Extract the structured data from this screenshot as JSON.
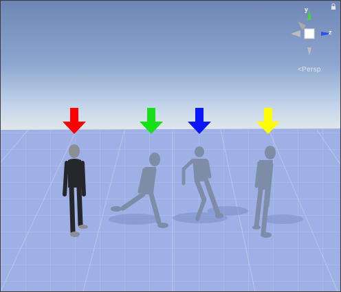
{
  "viewport": {
    "projection_label": "Persp"
  },
  "gizmo": {
    "axes": {
      "y": "y",
      "z": "z"
    },
    "colors": {
      "y": "#46d246",
      "z": "#2f52e0",
      "x_neg": "#bdbdbd",
      "center": "#ffffff"
    }
  },
  "markers": [
    {
      "name": "red",
      "color": "#ff0000"
    },
    {
      "name": "green",
      "color": "#18e018"
    },
    {
      "name": "blue",
      "color": "#0a16ff"
    },
    {
      "name": "yellow",
      "color": "#ffff00"
    }
  ],
  "characters": [
    {
      "name": "dark-figure",
      "color": "#25272b"
    },
    {
      "name": "walking-figure",
      "color": "#7d8da7"
    },
    {
      "name": "jumping-figure",
      "color": "#7d8da7"
    },
    {
      "name": "leaning-figure",
      "color": "#7d8da7"
    }
  ]
}
